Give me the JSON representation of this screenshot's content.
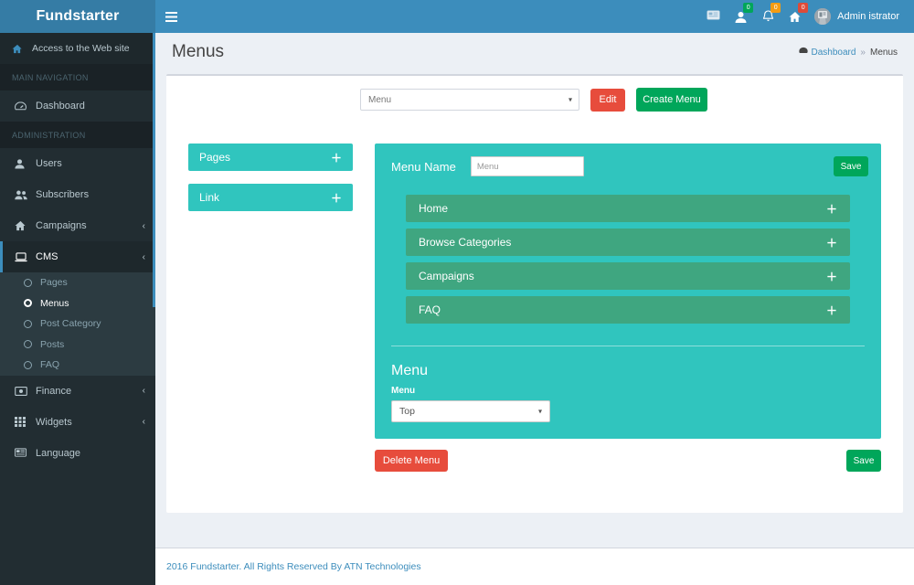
{
  "brand": {
    "name": "Fundstarter"
  },
  "navbar": {
    "menu_toggle_icon": "hamburger-icon",
    "icons": [
      {
        "name": "flag-icon",
        "badge": null,
        "badge_color": ""
      },
      {
        "name": "user-icon",
        "badge": "0",
        "badge_color": "#00a65a"
      },
      {
        "name": "bell-icon",
        "badge": "0",
        "badge_color": "#f39c12"
      },
      {
        "name": "home-icon",
        "badge": "0",
        "badge_color": "#dd4b39"
      }
    ],
    "user": {
      "name": "Admin istrator",
      "avatar_icon": "avatar-icon"
    }
  },
  "sidebar": {
    "site_link": {
      "label": "Access to the Web site",
      "icon": "home-icon"
    },
    "sections": [
      {
        "header": "MAIN NAVIGATION",
        "items": [
          {
            "label": "Dashboard",
            "icon": "dashboard-icon",
            "caret": ""
          }
        ]
      },
      {
        "header": "ADMINISTRATION",
        "items": [
          {
            "label": "Users",
            "icon": "user-icon",
            "caret": ""
          },
          {
            "label": "Subscribers",
            "icon": "users-icon",
            "caret": ""
          },
          {
            "label": "Campaigns",
            "icon": "home-icon",
            "caret": "‹"
          },
          {
            "label": "CMS",
            "icon": "laptop-icon",
            "caret": "‹",
            "active": true
          }
        ]
      }
    ],
    "submenu": [
      {
        "label": "Pages"
      },
      {
        "label": "Menus",
        "active": true
      },
      {
        "label": "Post Category"
      },
      {
        "label": "Posts"
      },
      {
        "label": "FAQ"
      }
    ],
    "tail_items": [
      {
        "label": "Finance",
        "icon": "money-icon",
        "caret": "‹"
      },
      {
        "label": "Widgets",
        "icon": "grid-icon",
        "caret": "‹"
      },
      {
        "label": "Language",
        "icon": "flag-icon",
        "caret": ""
      }
    ]
  },
  "page": {
    "title": "Menus",
    "breadcrumb": {
      "home_icon": "dashboard-icon",
      "home": "Dashboard",
      "sep": "»",
      "current": "Menus"
    }
  },
  "toolbar": {
    "menu_select": {
      "value": "Menu",
      "arrow": "▾"
    },
    "edit_label": "Edit",
    "create_label": "Create Menu"
  },
  "palette": {
    "panels": [
      {
        "label": "Pages",
        "plus": "＋"
      },
      {
        "label": "Link",
        "plus": "＋"
      }
    ]
  },
  "builder": {
    "menu_name_label": "Menu Name",
    "menu_name_value": "Menu",
    "save_top_label": "Save",
    "items": [
      {
        "label": "Home",
        "plus": "＋"
      },
      {
        "label": "Browse Categories",
        "plus": "＋"
      },
      {
        "label": "Campaigns",
        "plus": "＋"
      },
      {
        "label": "FAQ",
        "plus": "＋"
      }
    ],
    "settings": {
      "title": "Menu",
      "field_label": "Menu",
      "select_value": "Top",
      "arrow": "▾"
    },
    "delete_label": "Delete Menu",
    "save_bottom_label": "Save"
  },
  "footer": {
    "text": "2016 Fundstarter. All Rights Reserved By ATN Technologies"
  },
  "colors": {
    "navbar": "#3c8dbc",
    "logo": "#357ca5",
    "sidebar": "#222d32",
    "teal": "#30c5be",
    "green_item": "#3fa680",
    "success": "#00a65a",
    "danger": "#e74c3c",
    "link": "#3c8dbc"
  }
}
